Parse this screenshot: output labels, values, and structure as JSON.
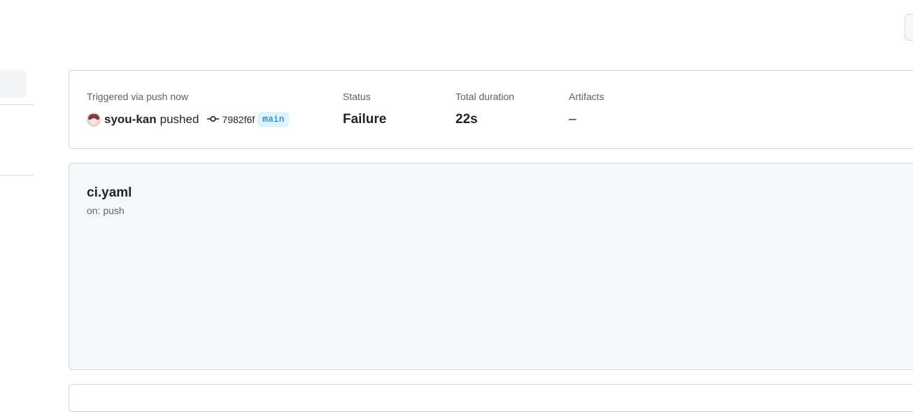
{
  "summary": {
    "trigger_label": "Triggered via push now",
    "actor": "syou-kan",
    "action": "pushed",
    "commit_sha": "7982f6f",
    "branch": "main",
    "status_label": "Status",
    "status_value": "Failure",
    "duration_label": "Total duration",
    "duration_value": "22s",
    "artifacts_label": "Artifacts",
    "artifacts_value": "–"
  },
  "workflow": {
    "name": "ci.yaml",
    "trigger": "on: push"
  },
  "icons": {
    "commit": "git-commit-icon",
    "avatar": "user-avatar"
  }
}
